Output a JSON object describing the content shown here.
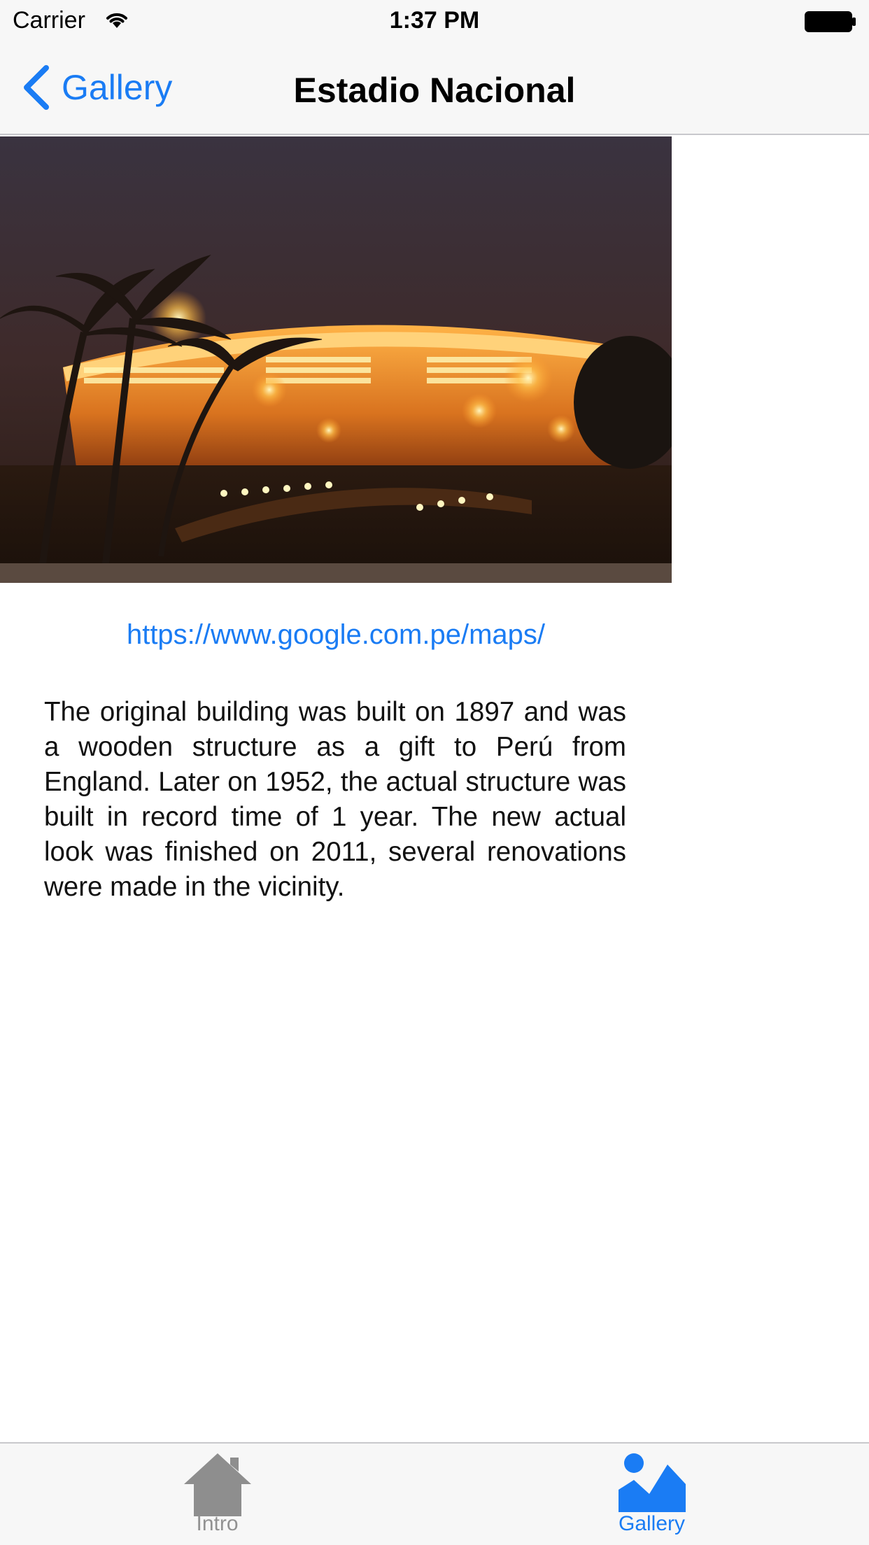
{
  "status_bar": {
    "carrier": "Carrier",
    "time": "1:37 PM",
    "wifi_icon": "wifi-icon",
    "battery_icon": "battery-full-icon"
  },
  "nav_bar": {
    "back_label": "Gallery",
    "back_icon": "chevron-left-icon",
    "title": "Estadio Nacional",
    "accent_color": "#1a7cf4"
  },
  "content": {
    "image_subject": "Estadio Nacional stadium at night",
    "link_text": "https://www.google.com.pe/maps/",
    "description": "The original building was built on 1897 and was a wooden structure as a gift to Perú from England. Later on 1952, the actual structure was built in record time of 1 year. The new actual look was finished on 2011, several renovations were made in the vicinity."
  },
  "tab_bar": {
    "tabs": [
      {
        "label": "Intro",
        "icon": "home-icon",
        "selected": false
      },
      {
        "label": "Gallery",
        "icon": "gallery-icon",
        "selected": true
      }
    ],
    "selected_color": "#1a7cf4",
    "unselected_color": "#929292"
  }
}
